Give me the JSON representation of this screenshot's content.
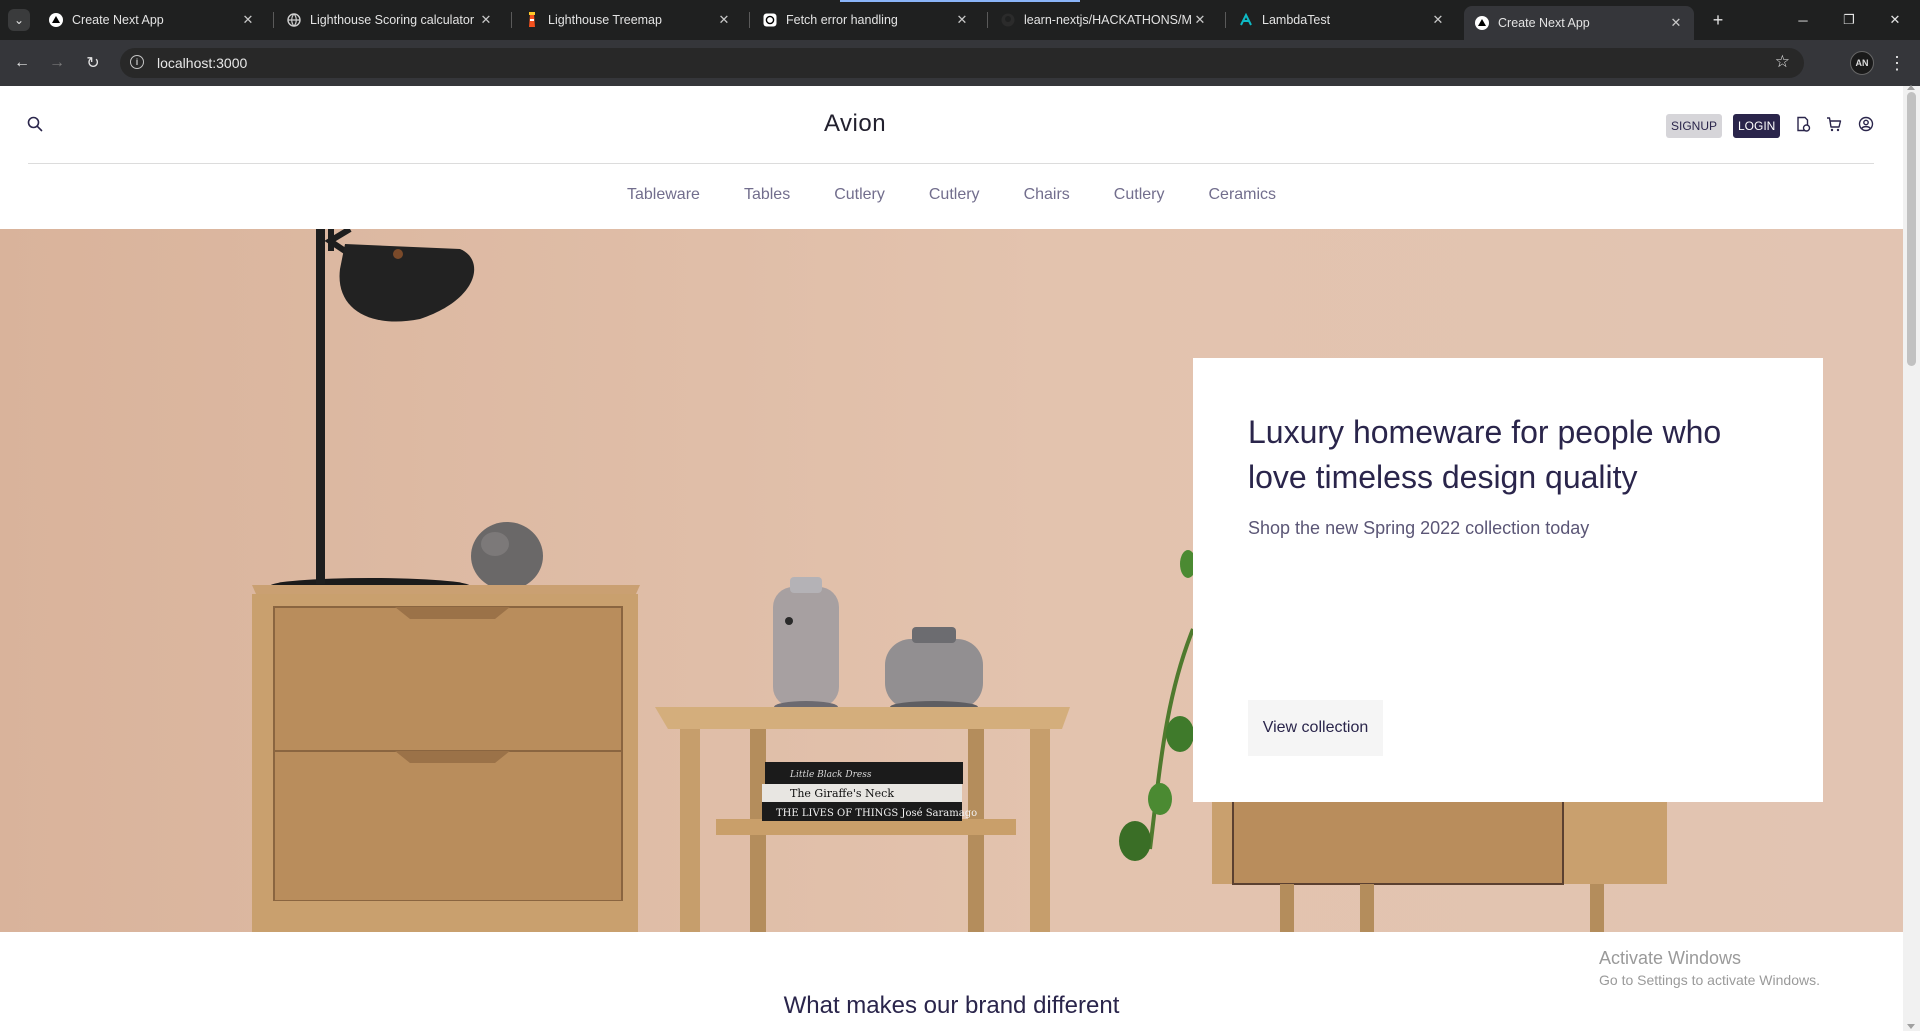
{
  "browser": {
    "tabs": [
      {
        "title": "Create Next App",
        "favicon": "triangle-icon"
      },
      {
        "title": "Lighthouse Scoring calculator",
        "favicon": "globe-icon"
      },
      {
        "title": "Lighthouse Treemap",
        "favicon": "lighthouse-icon"
      },
      {
        "title": "Fetch error handling",
        "favicon": "openai-icon"
      },
      {
        "title": "learn-nextjs/HACKATHONS/Ma",
        "favicon": "github-icon"
      },
      {
        "title": "LambdaTest",
        "favicon": "lambdatest-icon"
      },
      {
        "title": "Create Next App",
        "favicon": "triangle-icon",
        "active": true
      }
    ],
    "url": "localhost:3000"
  },
  "site": {
    "logo": "Avion",
    "signup_label": "SIGNUP",
    "login_label": "LOGIN",
    "categories": [
      "Tableware",
      "Tables",
      "Cutlery",
      "Cutlery",
      "Chairs",
      "Cutlery",
      "Ceramics"
    ]
  },
  "hero": {
    "title": "Luxury homeware for people who love timeless design quality",
    "subtitle": "Shop the new Spring 2022 collection today",
    "button_label": "View collection",
    "books": [
      "Little Black Dress",
      "The Giraffe's Neck",
      "THE LIVES OF THINGS José Saramago"
    ]
  },
  "section": {
    "title": "What makes our brand different"
  },
  "os_overlay": {
    "line1": "Activate Windows",
    "line2": "Go to Settings to activate Windows."
  },
  "colors": {
    "brand_dark": "#2a254b",
    "hero_bg": "#e0bea9",
    "chrome_dark": "#1f2020"
  }
}
